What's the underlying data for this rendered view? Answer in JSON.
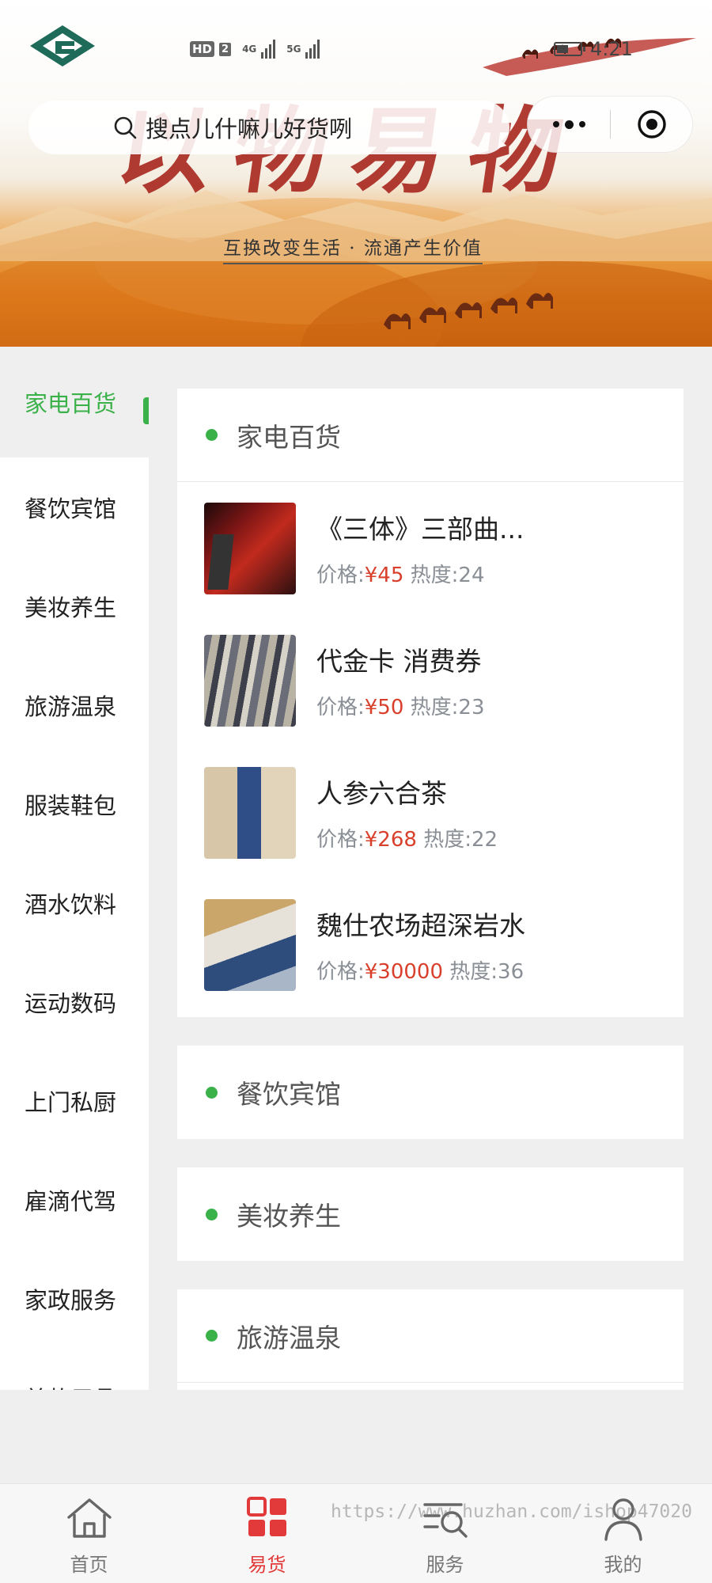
{
  "status_bar": {
    "hd": "HD",
    "sim": "2",
    "net1": "4G",
    "net2": "5G",
    "time": "4:21"
  },
  "hero": {
    "brush_title": "以物易物",
    "slogan": "互换改变生活 · 流通产生价值"
  },
  "search": {
    "placeholder": "搜点儿什嘛儿好货咧"
  },
  "sidebar": {
    "items": [
      {
        "label": "家电百货",
        "active": true
      },
      {
        "label": "餐饮宾馆"
      },
      {
        "label": "美妆养生"
      },
      {
        "label": "旅游温泉"
      },
      {
        "label": "服装鞋包"
      },
      {
        "label": "酒水饮料"
      },
      {
        "label": "运动数码"
      },
      {
        "label": "上门私厨"
      },
      {
        "label": "雇滴代驾"
      },
      {
        "label": "家政服务"
      },
      {
        "label": "美妆用品"
      }
    ]
  },
  "content": {
    "categories": [
      {
        "title": "家电百货",
        "products": [
          {
            "name": "《三体》三部曲...",
            "price_label": "价格:",
            "price": "¥45",
            "heat": "热度:24"
          },
          {
            "name": "代金卡 消费券",
            "price_label": "价格:",
            "price": "¥50",
            "heat": "热度:23"
          },
          {
            "name": "人参六合茶",
            "price_label": "价格:",
            "price": "¥268",
            "heat": "热度:22"
          },
          {
            "name": "魏仕农场超深岩水",
            "price_label": "价格:",
            "price": "¥30000",
            "heat": "热度:36"
          }
        ]
      },
      {
        "title": "餐饮宾馆"
      },
      {
        "title": "美妆养生"
      },
      {
        "title": "旅游温泉"
      }
    ]
  },
  "tabbar": {
    "tabs": [
      {
        "label": "首页"
      },
      {
        "label": "易货",
        "active": true
      },
      {
        "label": "服务"
      },
      {
        "label": "我的"
      }
    ]
  },
  "watermark": "https://www.huzhan.com/ishop47020",
  "colors": {
    "accent_green": "#3bb14a",
    "price_red": "#d9402c",
    "active_tab_red": "#e23a3a"
  }
}
